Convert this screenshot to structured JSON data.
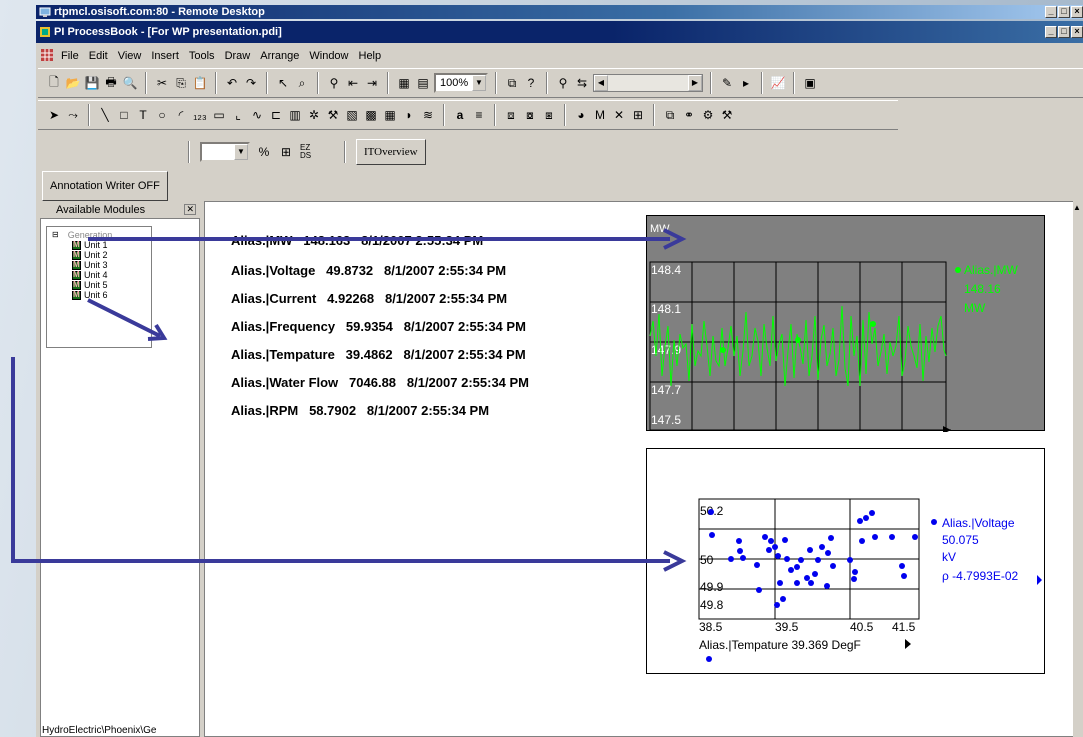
{
  "remote_title": "rtpmcl.osisoft.com:80 - Remote Desktop",
  "app_title": "PI ProcessBook - [For WP presentation.pdi]",
  "window_buttons": [
    "_",
    "□",
    "×"
  ],
  "menu": [
    "File",
    "Edit",
    "View",
    "Insert",
    "Tools",
    "Draw",
    "Arrange",
    "Window",
    "Help"
  ],
  "toolbar": {
    "zoom": "100%",
    "ez_ds": "EZ DS",
    "overview_button": "ITOverview"
  },
  "annotation_button": "Annotation Writer OFF",
  "modules_panel": {
    "title": "Available Modules",
    "root": "Generation",
    "units": [
      "Unit 1",
      "Unit 2",
      "Unit 3",
      "Unit 4",
      "Unit 5",
      "Unit 6"
    ],
    "path": "HydroElectric\\Phoenix\\Ge"
  },
  "values": [
    {
      "name": "Alias.|MW",
      "value": "148.163",
      "time": "8/1/2007 2:55:34 PM"
    },
    {
      "name": "Alias.|Voltage",
      "value": "49.8732",
      "time": "8/1/2007 2:55:34 PM"
    },
    {
      "name": "Alias.|Current",
      "value": "4.92268",
      "time": "8/1/2007 2:55:34 PM"
    },
    {
      "name": "Alias.|Frequency",
      "value": "59.9354",
      "time": "8/1/2007 2:55:34 PM"
    },
    {
      "name": "Alias.|Tempature",
      "value": "39.4862",
      "time": "8/1/2007 2:55:34 PM"
    },
    {
      "name": "Alias.|Water Flow",
      "value": "7046.88",
      "time": "8/1/2007 2:55:34 PM"
    },
    {
      "name": "Alias.|RPM",
      "value": "58.7902",
      "time": "8/1/2007 2:55:34 PM"
    }
  ],
  "colors": {
    "accent_arrow": "#3a3a9a",
    "trend_line": "#00ff00",
    "xy_points": "#0000ee"
  },
  "trend": {
    "y_unit": "MW",
    "y_ticks": [
      "148.4",
      "148.1",
      "147.9",
      "147.7",
      "147.5"
    ],
    "legend_name": "Alias.|MW",
    "legend_value": "148.16",
    "legend_unit": "MW"
  },
  "xy": {
    "y_ticks": [
      "50.2",
      "50",
      "49.9",
      "49.8"
    ],
    "x_ticks": [
      "38.5",
      "39.5",
      "40.5",
      "41.5"
    ],
    "legend_name": "Alias.|Voltage",
    "legend_value": "50.075",
    "legend_unit": "kV",
    "legend_rho": "ρ -4.7993E-02",
    "x_label": "Alias.|Tempature 39.369  DegF"
  }
}
